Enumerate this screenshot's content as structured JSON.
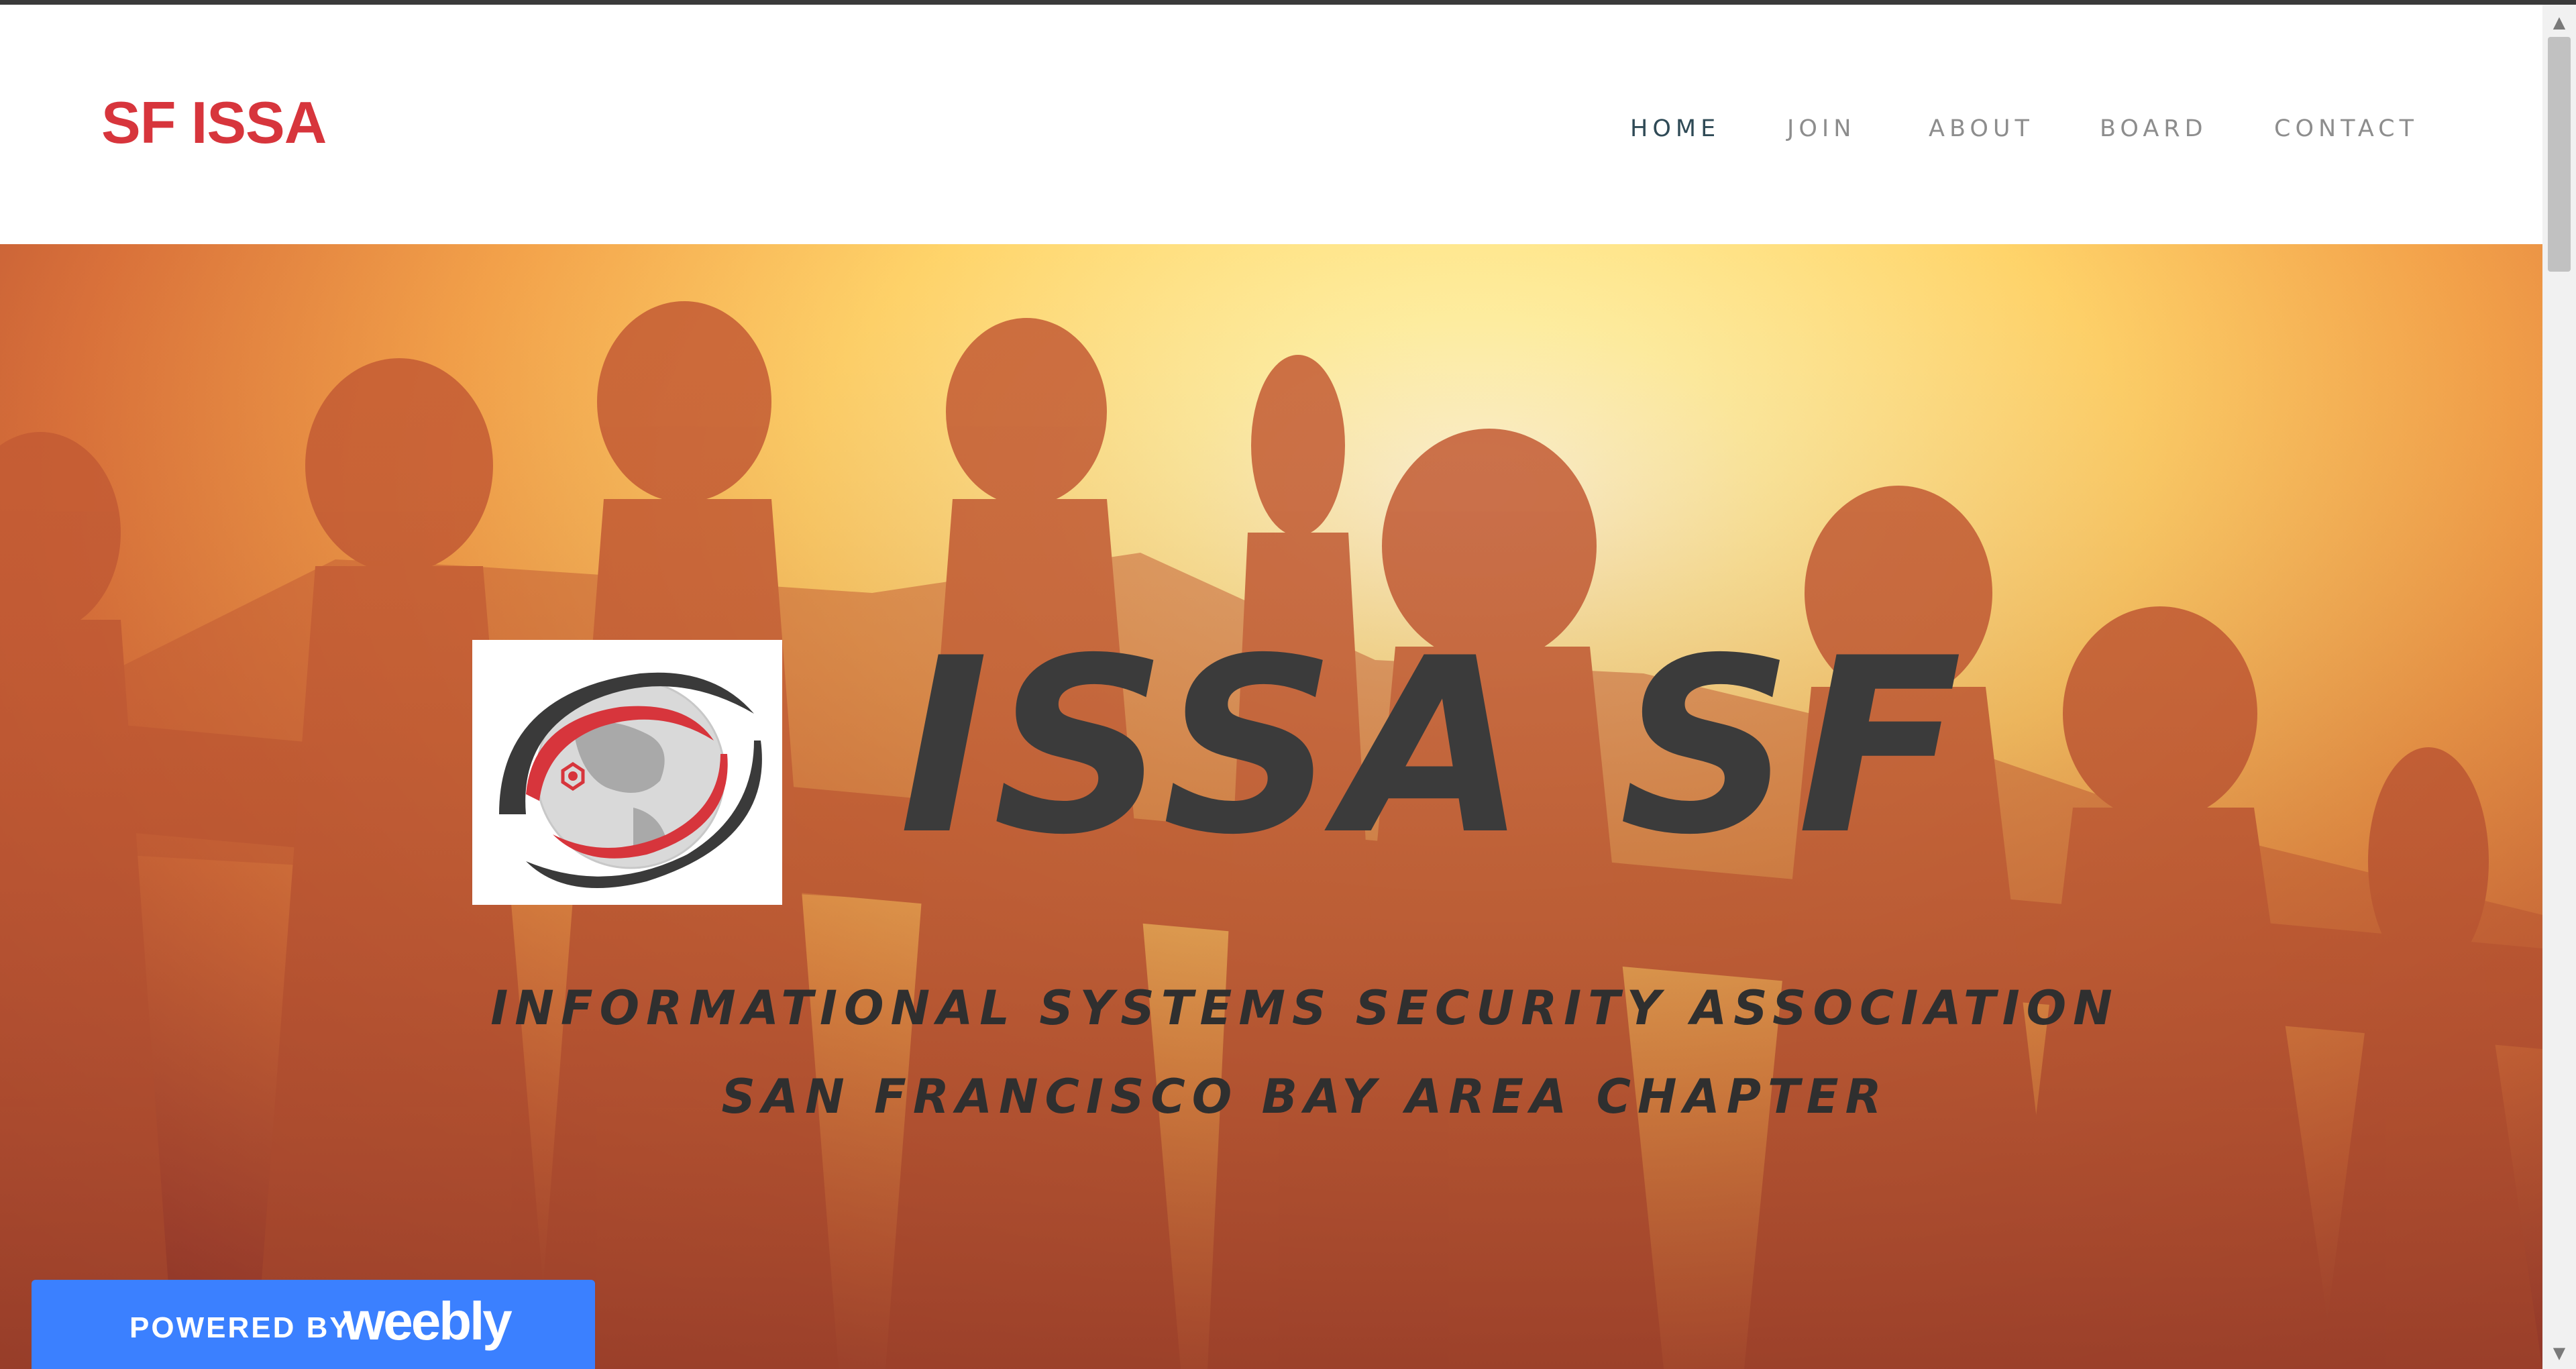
{
  "site": {
    "brand": "SF ISSA"
  },
  "nav": {
    "items": [
      {
        "label": "HOME",
        "active": true
      },
      {
        "label": "JOIN",
        "active": false
      },
      {
        "label": "ABOUT",
        "active": false
      },
      {
        "label": "BOARD",
        "active": false
      },
      {
        "label": "CONTACT",
        "active": false
      }
    ]
  },
  "hero": {
    "title": "ISSA SF",
    "subtitle_line1": "INFORMATIONAL SYSTEMS SECURITY ASSOCIATION",
    "subtitle_line2": "SAN FRANCISCO BAY AREA CHAPTER",
    "background": "paper-chain-people-silhouette-image"
  },
  "badge": {
    "powered": "POWERED BY",
    "brand": "weebly"
  },
  "colors": {
    "brand": "#d7353c",
    "nav_active": "#2f4a56",
    "nav_inactive": "#8d8d8d",
    "hero_text": "#3b3b3b",
    "badge_bg": "#3b80ff"
  },
  "icons": {
    "logo": "globe-logo-icon",
    "scroll_up": "scroll-up-arrow-icon",
    "scroll_down": "scroll-down-arrow-icon"
  }
}
